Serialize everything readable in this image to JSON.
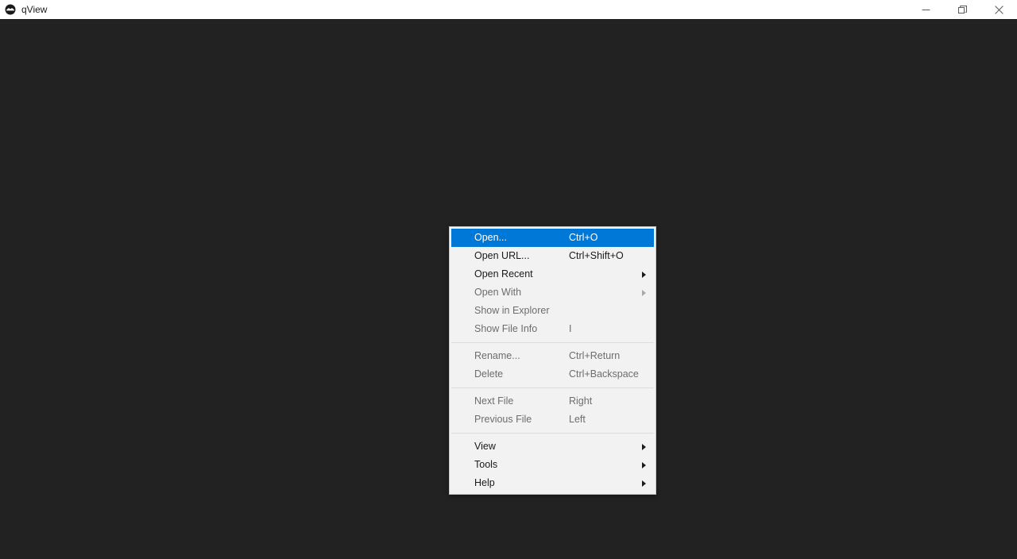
{
  "window": {
    "title": "qView",
    "app_icon": "qview-logo-icon",
    "background_color": "#222222",
    "titlebar_background": "#ffffff",
    "controls": [
      {
        "name": "minimize",
        "icon": "minimize-icon",
        "label": "Minimize"
      },
      {
        "name": "maximize",
        "icon": "restore-icon",
        "label": "Restore"
      },
      {
        "name": "close",
        "icon": "close-icon",
        "label": "Close"
      }
    ]
  },
  "context_menu": {
    "highlight_color": "#0078d7",
    "background_color": "#f2f2f2",
    "border_color": "#c8c8c8",
    "enabled_text_color": "#1a1a1a",
    "disabled_text_color": "#6d6d6d",
    "sections": [
      {
        "items": [
          {
            "label": "Open...",
            "shortcut": "Ctrl+O",
            "enabled": true,
            "highlighted": true,
            "submenu": false
          },
          {
            "label": "Open URL...",
            "shortcut": "Ctrl+Shift+O",
            "enabled": true,
            "highlighted": false,
            "submenu": false
          },
          {
            "label": "Open Recent",
            "shortcut": "",
            "enabled": true,
            "highlighted": false,
            "submenu": true
          },
          {
            "label": "Open With",
            "shortcut": "",
            "enabled": false,
            "highlighted": false,
            "submenu": true
          },
          {
            "label": "Show in Explorer",
            "shortcut": "",
            "enabled": false,
            "highlighted": false,
            "submenu": false
          },
          {
            "label": "Show File Info",
            "shortcut": "I",
            "enabled": false,
            "highlighted": false,
            "submenu": false
          }
        ]
      },
      {
        "items": [
          {
            "label": "Rename...",
            "shortcut": "Ctrl+Return",
            "enabled": false,
            "highlighted": false,
            "submenu": false
          },
          {
            "label": "Delete",
            "shortcut": "Ctrl+Backspace",
            "enabled": false,
            "highlighted": false,
            "submenu": false
          }
        ]
      },
      {
        "items": [
          {
            "label": "Next File",
            "shortcut": "Right",
            "enabled": false,
            "highlighted": false,
            "submenu": false
          },
          {
            "label": "Previous File",
            "shortcut": "Left",
            "enabled": false,
            "highlighted": false,
            "submenu": false
          }
        ]
      },
      {
        "items": [
          {
            "label": "View",
            "shortcut": "",
            "enabled": true,
            "highlighted": false,
            "submenu": true
          },
          {
            "label": "Tools",
            "shortcut": "",
            "enabled": true,
            "highlighted": false,
            "submenu": true
          },
          {
            "label": "Help",
            "shortcut": "",
            "enabled": true,
            "highlighted": false,
            "submenu": true
          }
        ]
      }
    ]
  }
}
